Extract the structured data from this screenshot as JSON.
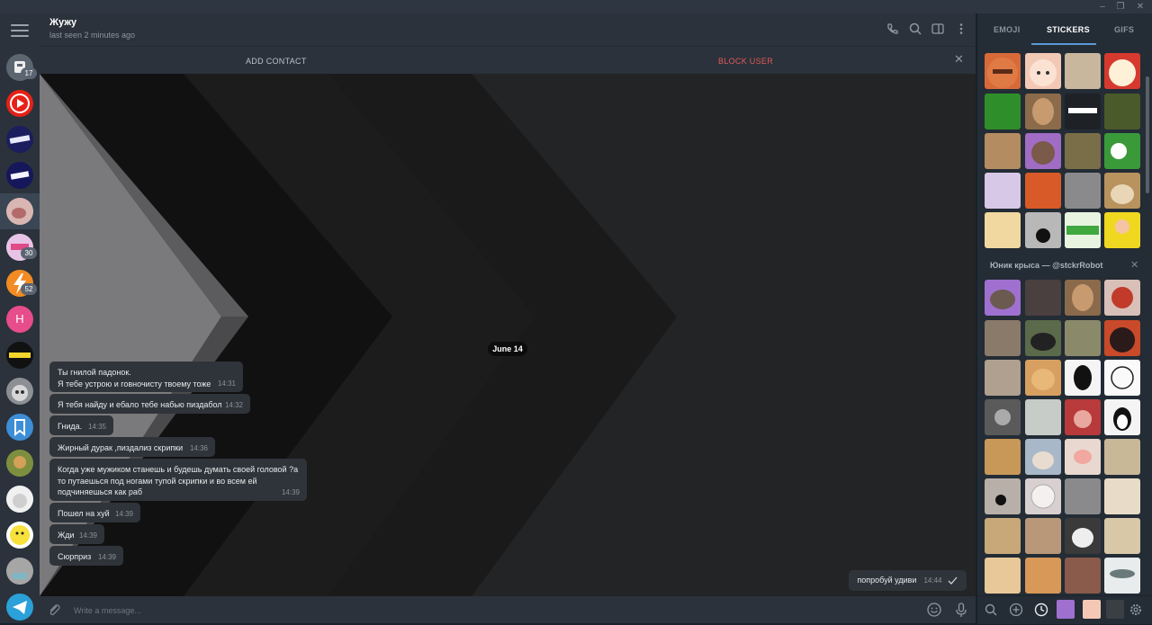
{
  "chat": {
    "name": "Жужу",
    "status": "last seen 2 minutes ago"
  },
  "actions": {
    "add_contact": "ADD CONTACT",
    "block_user": "BLOCK USER"
  },
  "date_pill": "June 14",
  "messages": [
    {
      "text": "Ты гнилой падонок.\nЯ тебе устрою и говночисту твоему тоже",
      "time": "14:31"
    },
    {
      "text": "Я тебя найду и ебало тебе набью пиздабол",
      "time": "14:32"
    },
    {
      "text": "Гнида.",
      "time": "14:35"
    },
    {
      "text": "Жирный дурак ,пиздализ скрипки",
      "time": "14:36"
    },
    {
      "text": "Когда уже мужиком станешь и будешь думать своей головой ?а\nто путаешься под ногами тупой скрипки и во всем ей\nподчиняешься как раб",
      "time": "14:39"
    },
    {
      "text": "Пошел на хуй",
      "time": "14:39"
    },
    {
      "text": "Жди",
      "time": "14:39"
    },
    {
      "text": "Сюрприз",
      "time": "14:39"
    }
  ],
  "outgoing": {
    "text": "попробуй удиви",
    "time": "14:44"
  },
  "composer": {
    "placeholder": "Write a message..."
  },
  "rail_badges": {
    "saved": "17",
    "chat5": "30",
    "chat6": "52"
  },
  "rail_letter": "H",
  "panel": {
    "tabs": [
      "EMOJI",
      "STICKERS",
      "GIFS"
    ],
    "active_tab": "STICKERS",
    "pack_title": "Юник крыса — @stckrRobot"
  },
  "colors": {
    "block": "#e0595a",
    "accent": "#5a9ad6",
    "bubble": "#2f343a"
  }
}
